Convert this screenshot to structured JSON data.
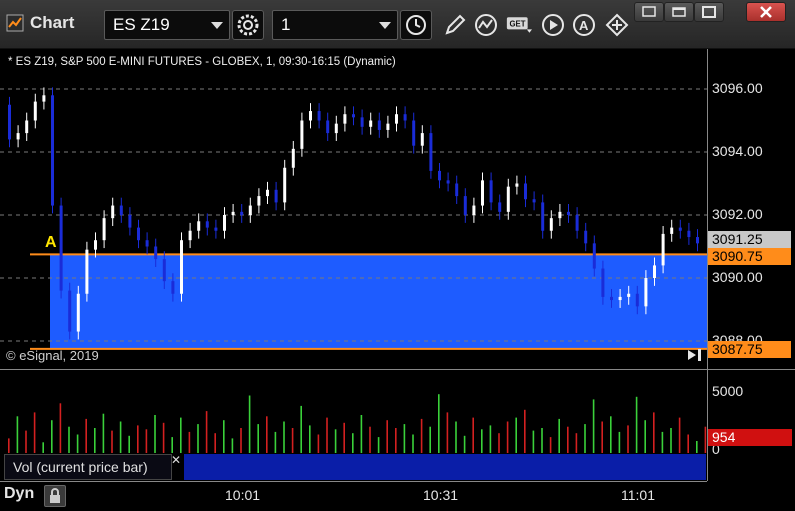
{
  "window": {
    "title": "Chart",
    "symbol": "ES Z19",
    "interval": "1",
    "icons": [
      "chart-window-icon",
      "settings-gear-icon",
      "clock-icon",
      "pencil-draw-icon",
      "squiggle-study-icon",
      "get-data-icon",
      "play-icon",
      "alert-a-icon",
      "cursor-icon"
    ]
  },
  "chart": {
    "info": "* ES Z19, S&P 500 E-MINI FUTURES - GLOBEX, 1, 09:30-16:15 (Dynamic)",
    "copyright": "© eSignal, 2019",
    "marker": "A",
    "price_labels": [
      "3096.00",
      "3094.00",
      "3092.00",
      "3090.00",
      "3088.00"
    ],
    "tags": {
      "last": "3091.25",
      "level_high": "3090.75",
      "level_low": "3087.75"
    },
    "colors": {
      "up": "#ffffff",
      "down": "#1a2cd8",
      "zone": "#1e5cff",
      "level": "#ff8c1a",
      "vol_up": "#3ad13a",
      "vol_down": "#d42020"
    }
  },
  "volume": {
    "axis_labels": [
      "5000",
      "0"
    ],
    "current": "954",
    "study_label": "Vol (current price bar)"
  },
  "time_axis": {
    "dyn": "Dyn",
    "labels": [
      "10:01",
      "10:31",
      "11:01"
    ]
  },
  "chart_data": {
    "type": "table",
    "price_range": [
      3087.75,
      3096.8
    ],
    "level_high": 3090.75,
    "level_low": 3087.75,
    "last_price": 3091.25,
    "volume_current": 954,
    "volume_ylim": [
      0,
      6000
    ]
  }
}
